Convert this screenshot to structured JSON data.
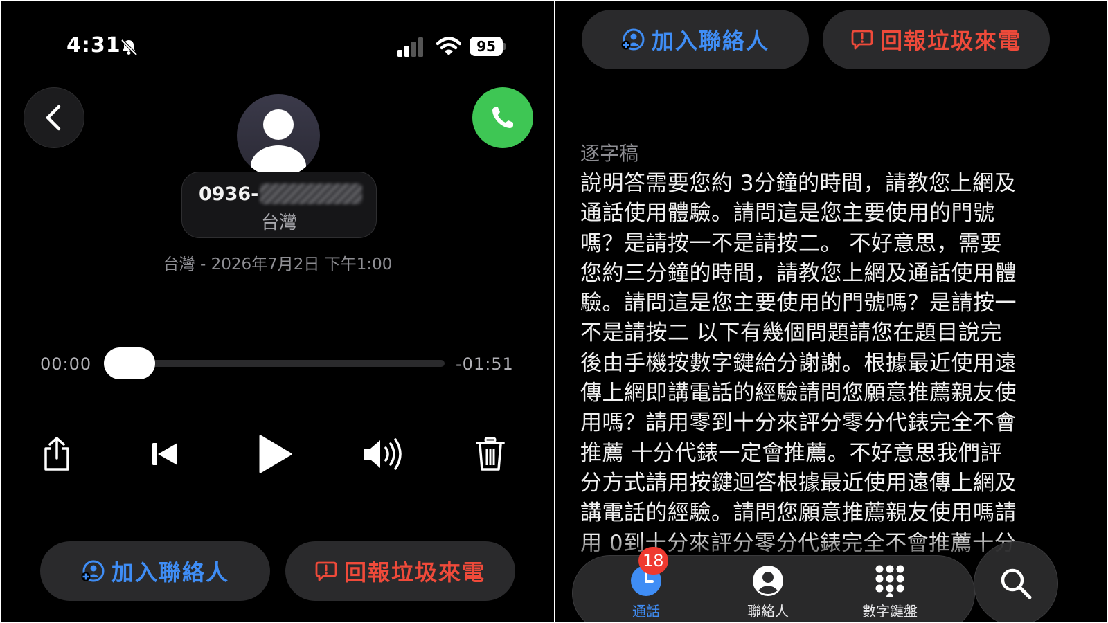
{
  "status_bar": {
    "time": "4:31",
    "battery": "95"
  },
  "contact": {
    "number_prefix": "0936-",
    "location": "台灣",
    "date_line": "台灣 - 2026年7月2日 下午1:00"
  },
  "player": {
    "elapsed": "00:00",
    "remaining": "-01:51",
    "progress": 0.0
  },
  "actions": {
    "add_contact": "加入聯絡人",
    "report_spam": "回報垃圾來電"
  },
  "transcript": {
    "title": "逐字稿",
    "lines": [
      "說明答需要您約 3分鐘的時間，請教您上網及",
      "通話使用體驗。請問這是您主要使用的門號",
      "嗎？是請按一不是請按二。  不好意思，需要",
      "您約三分鐘的時間，請教您上網及通話使用體",
      "驗。請問這是您主要使用的門號嗎？是請按一",
      "不是請按二 以下有幾個問題請您在題目說完",
      "後由手機按數字鍵給分謝謝。根據最近使用遠",
      "傳上網即講電話的經驗請問您願意推薦親友使",
      "用嗎？請用零到十分來評分零分代錶完全不會",
      "推薦 十分代錶一定會推薦。不好意思我們評",
      "分方式請用按鍵迴答根據最近使用遠傳上網及",
      "講電話的經驗。請問您願意推薦親友使用嗎請",
      "用 0到十分來評分零分代錶完全不會推薦十分"
    ]
  },
  "tabs": [
    {
      "label": "通話",
      "icon": "clock-icon",
      "active": true
    },
    {
      "label": "聯絡人",
      "icon": "person-circle-icon",
      "active": false
    },
    {
      "label": "數字鍵盤",
      "icon": "keypad-icon",
      "active": false
    }
  ],
  "badge_count": "18",
  "colors": {
    "accent_blue": "#3f8df5",
    "danger_red": "#ef4a3a",
    "call_green": "#3ec654",
    "badge_red": "#ef3a30"
  }
}
